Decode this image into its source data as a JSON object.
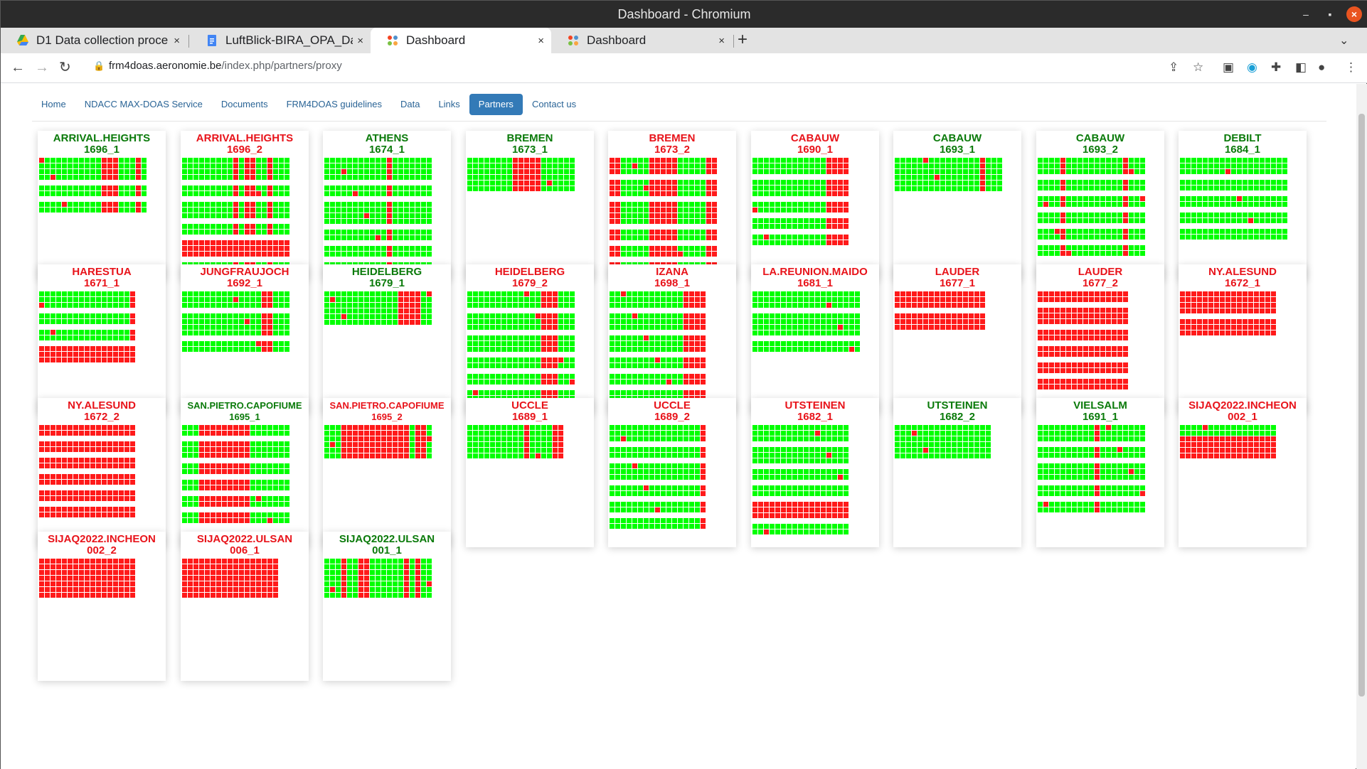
{
  "window": {
    "title": "Dashboard - Chromium",
    "controls": [
      "–",
      "▪",
      "×"
    ]
  },
  "tabs": [
    {
      "label": "D1 Data collection proce",
      "icon": "google-drive-icon",
      "close": "×"
    },
    {
      "label": "LuftBlick-BIRA_OPA_Da",
      "icon": "google-docs-icon",
      "close": "×"
    },
    {
      "label": "Dashboard",
      "icon": "joomla-icon",
      "close": "×"
    },
    {
      "label": "Dashboard",
      "icon": "joomla-icon",
      "close": "×"
    }
  ],
  "address": {
    "host": "frm4doas.aeronomie.be",
    "path": "/index.php/partners/proxy"
  },
  "nav": [
    "Home",
    "NDACC MAX-DOAS Service",
    "Documents",
    "FRM4DOAS guidelines",
    "Data",
    "Links",
    "Partners",
    "Contact us"
  ],
  "nav_active": 6,
  "colors": {
    "ok": "#00ff00",
    "fail": "#ff1a1a",
    "title_ok": "#0a7a0a",
    "title_fail": "#e8131a",
    "nav_active": "#337ab7"
  },
  "stations": [
    {
      "name": "ARRIVAL.HEIGHTS",
      "id": "1696_1",
      "status": "ok",
      "cols": 19,
      "groups": [
        [
          "g",
          4
        ],
        [
          "s",
          0
        ],
        [
          "g",
          2
        ],
        [
          "s",
          0
        ],
        [
          "g",
          2
        ]
      ],
      "red_cols": [
        [
          11,
          11
        ],
        [
          12,
          13
        ],
        [
          17,
          17
        ]
      ]
    },
    {
      "name": "ARRIVAL.HEIGHTS",
      "id": "1696_2",
      "status": "fail",
      "cols": 19,
      "groups": [
        [
          "g",
          4
        ],
        [
          "s",
          0
        ],
        [
          "g",
          2
        ],
        [
          "s",
          0
        ],
        [
          "g",
          3
        ],
        [
          "s",
          0
        ],
        [
          "g",
          2
        ],
        [
          "s",
          0
        ],
        [
          "r",
          3
        ],
        [
          "s",
          0
        ],
        [
          "g",
          2
        ]
      ],
      "red_cols": [
        [
          9,
          9
        ],
        [
          11,
          12
        ],
        [
          15,
          15
        ]
      ]
    },
    {
      "name": "ATHENS",
      "id": "1674_1",
      "status": "ok",
      "cols": 19,
      "groups": [
        [
          "g",
          4
        ],
        [
          "s",
          0
        ],
        [
          "g",
          2
        ],
        [
          "s",
          0
        ],
        [
          "g",
          4
        ],
        [
          "s",
          0
        ],
        [
          "g",
          2
        ],
        [
          "s",
          0
        ],
        [
          "g",
          2
        ],
        [
          "s",
          0
        ],
        [
          "g",
          2
        ]
      ],
      "red_cols": [
        [
          11,
          11
        ]
      ]
    },
    {
      "name": "BREMEN",
      "id": "1673_1",
      "status": "ok",
      "cols": 19,
      "groups": [
        [
          "g",
          6
        ]
      ],
      "red_cols": [
        [
          8,
          11
        ],
        [
          12,
          12
        ]
      ]
    },
    {
      "name": "BREMEN",
      "id": "1673_2",
      "status": "fail",
      "cols": 19,
      "groups": [
        [
          "g",
          3
        ],
        [
          "s",
          0
        ],
        [
          "g",
          3
        ],
        [
          "s",
          0
        ],
        [
          "g",
          4
        ],
        [
          "s",
          0
        ],
        [
          "g",
          2
        ],
        [
          "s",
          0
        ],
        [
          "g",
          2
        ],
        [
          "s",
          0
        ],
        [
          "g",
          2
        ]
      ],
      "red_cols": [
        [
          0,
          1
        ],
        [
          7,
          11
        ],
        [
          17,
          18
        ]
      ]
    },
    {
      "name": "CABAUW",
      "id": "1690_1",
      "status": "fail",
      "cols": 17,
      "groups": [
        [
          "g",
          3
        ],
        [
          "s",
          0
        ],
        [
          "g",
          3
        ],
        [
          "s",
          0
        ],
        [
          "g",
          2
        ],
        [
          "s",
          0
        ],
        [
          "g",
          2
        ],
        [
          "s",
          0
        ],
        [
          "g",
          2
        ]
      ],
      "red_cols": [
        [
          13,
          16
        ]
      ]
    },
    {
      "name": "CABAUW",
      "id": "1693_1",
      "status": "ok",
      "cols": 19,
      "groups": [
        [
          "g",
          6
        ]
      ],
      "red_cols": [
        [
          15,
          15
        ]
      ]
    },
    {
      "name": "CABAUW",
      "id": "1693_2",
      "status": "ok",
      "cols": 19,
      "groups": [
        [
          "g",
          3
        ],
        [
          "s",
          0
        ],
        [
          "g",
          2
        ],
        [
          "s",
          0
        ],
        [
          "g",
          2
        ],
        [
          "s",
          0
        ],
        [
          "g",
          2
        ],
        [
          "s",
          0
        ],
        [
          "g",
          2
        ],
        [
          "s",
          0
        ],
        [
          "g",
          2
        ]
      ],
      "red_cols": [
        [
          4,
          4
        ],
        [
          15,
          15
        ]
      ]
    },
    {
      "name": "DEBILT",
      "id": "1684_1",
      "status": "ok",
      "cols": 19,
      "groups": [
        [
          "g",
          3
        ],
        [
          "s",
          0
        ],
        [
          "g",
          2
        ],
        [
          "s",
          0
        ],
        [
          "g",
          2
        ],
        [
          "s",
          0
        ],
        [
          "g",
          2
        ],
        [
          "s",
          0
        ],
        [
          "g",
          2
        ]
      ],
      "red_cols": []
    },
    {
      "name": "HARESTUA",
      "id": "1671_1",
      "status": "fail",
      "cols": 17,
      "groups": [
        [
          "g",
          3
        ],
        [
          "s",
          0
        ],
        [
          "g",
          2
        ],
        [
          "s",
          0
        ],
        [
          "g",
          2
        ],
        [
          "s",
          0
        ],
        [
          "r",
          3
        ]
      ],
      "red_cols": [
        [
          16,
          16
        ]
      ]
    },
    {
      "name": "JUNGFRAUJOCH",
      "id": "1692_1",
      "status": "fail",
      "cols": 19,
      "groups": [
        [
          "g",
          3
        ],
        [
          "s",
          0
        ],
        [
          "g",
          4
        ],
        [
          "s",
          0
        ],
        [
          "g",
          2
        ]
      ],
      "red_cols": [
        [
          14,
          15
        ]
      ]
    },
    {
      "name": "HEIDELBERG",
      "id": "1679_1",
      "status": "ok",
      "cols": 19,
      "groups": [
        [
          "g",
          6
        ]
      ],
      "red_cols": [
        [
          13,
          16
        ]
      ]
    },
    {
      "name": "HEIDELBERG",
      "id": "1679_2",
      "status": "fail",
      "cols": 19,
      "groups": [
        [
          "g",
          3
        ],
        [
          "s",
          0
        ],
        [
          "g",
          3
        ],
        [
          "s",
          0
        ],
        [
          "g",
          3
        ],
        [
          "s",
          0
        ],
        [
          "g",
          2
        ],
        [
          "s",
          0
        ],
        [
          "g",
          2
        ],
        [
          "s",
          0
        ],
        [
          "g",
          2
        ],
        [
          "s",
          0
        ],
        [
          "g",
          2
        ]
      ],
      "red_cols": [
        [
          13,
          15
        ]
      ]
    },
    {
      "name": "IZANA",
      "id": "1698_1",
      "status": "fail",
      "cols": 17,
      "groups": [
        [
          "g",
          3
        ],
        [
          "s",
          0
        ],
        [
          "g",
          3
        ],
        [
          "s",
          0
        ],
        [
          "g",
          3
        ],
        [
          "s",
          0
        ],
        [
          "g",
          2
        ],
        [
          "s",
          0
        ],
        [
          "g",
          2
        ],
        [
          "s",
          0
        ],
        [
          "g",
          2
        ]
      ],
      "red_cols": [
        [
          13,
          16
        ]
      ]
    },
    {
      "name": "LA.REUNION.MAIDO",
      "id": "1681_1",
      "status": "fail",
      "cols": 19,
      "groups": [
        [
          "g",
          3
        ],
        [
          "s",
          0
        ],
        [
          "g",
          4
        ],
        [
          "s",
          0
        ],
        [
          "g",
          2
        ]
      ],
      "red_cols": []
    },
    {
      "name": "LAUDER",
      "id": "1677_1",
      "status": "fail",
      "cols": 16,
      "groups": [
        [
          "r",
          3
        ],
        [
          "s",
          0
        ],
        [
          "r",
          3
        ]
      ],
      "red_cols": []
    },
    {
      "name": "LAUDER",
      "id": "1677_2",
      "status": "fail",
      "cols": 16,
      "groups": [
        [
          "r",
          2
        ],
        [
          "s",
          0
        ],
        [
          "r",
          3
        ],
        [
          "s",
          0
        ],
        [
          "r",
          2
        ],
        [
          "s",
          0
        ],
        [
          "r",
          2
        ],
        [
          "s",
          0
        ],
        [
          "r",
          2
        ],
        [
          "s",
          0
        ],
        [
          "r",
          2
        ]
      ],
      "red_cols": []
    },
    {
      "name": "NY.ALESUND",
      "id": "1672_1",
      "status": "fail",
      "cols": 17,
      "groups": [
        [
          "r",
          4
        ],
        [
          "s",
          0
        ],
        [
          "r",
          3
        ]
      ],
      "red_cols": []
    },
    {
      "name": "NY.ALESUND",
      "id": "1672_2",
      "status": "fail",
      "cols": 17,
      "groups": [
        [
          "r",
          2
        ],
        [
          "s",
          0
        ],
        [
          "r",
          2
        ],
        [
          "s",
          0
        ],
        [
          "r",
          2
        ],
        [
          "s",
          0
        ],
        [
          "r",
          2
        ],
        [
          "s",
          0
        ],
        [
          "r",
          2
        ],
        [
          "s",
          0
        ],
        [
          "r",
          2
        ]
      ],
      "red_cols": []
    },
    {
      "name": "SAN.PIETRO.CAPOFIUME",
      "id": "1695_1",
      "status": "ok",
      "cols": 19,
      "groups": [
        [
          "g",
          2
        ],
        [
          "s",
          0
        ],
        [
          "g",
          3
        ],
        [
          "s",
          0
        ],
        [
          "g",
          2
        ],
        [
          "s",
          0
        ],
        [
          "g",
          2
        ],
        [
          "s",
          0
        ],
        [
          "g",
          2
        ],
        [
          "s",
          0
        ],
        [
          "g",
          2
        ]
      ],
      "red_cols": [
        [
          3,
          11
        ]
      ]
    },
    {
      "name": "SAN.PIETRO.CAPOFIUME",
      "id": "1695_2",
      "status": "fail",
      "cols": 19,
      "groups": [
        [
          "g",
          6
        ]
      ],
      "red_cols": [
        [
          3,
          14
        ],
        [
          16,
          17
        ]
      ]
    },
    {
      "name": "UCCLE",
      "id": "1689_1",
      "status": "fail",
      "cols": 17,
      "groups": [
        [
          "g",
          6
        ]
      ],
      "red_cols": [
        [
          10,
          10
        ],
        [
          15,
          16
        ]
      ]
    },
    {
      "name": "UCCLE",
      "id": "1689_2",
      "status": "fail",
      "cols": 17,
      "groups": [
        [
          "g",
          3
        ],
        [
          "s",
          0
        ],
        [
          "g",
          2
        ],
        [
          "s",
          0
        ],
        [
          "g",
          3
        ],
        [
          "s",
          0
        ],
        [
          "g",
          2
        ],
        [
          "s",
          0
        ],
        [
          "g",
          2
        ],
        [
          "s",
          0
        ],
        [
          "g",
          2
        ]
      ],
      "red_cols": [
        [
          16,
          16
        ]
      ]
    },
    {
      "name": "UTSTEINEN",
      "id": "1682_1",
      "status": "fail",
      "cols": 17,
      "groups": [
        [
          "g",
          3
        ],
        [
          "s",
          0
        ],
        [
          "g",
          3
        ],
        [
          "s",
          0
        ],
        [
          "g",
          2
        ],
        [
          "s",
          0
        ],
        [
          "g",
          2
        ],
        [
          "s",
          0
        ],
        [
          "r",
          3
        ],
        [
          "s",
          0
        ],
        [
          "g",
          2
        ]
      ],
      "red_cols": []
    },
    {
      "name": "UTSTEINEN",
      "id": "1682_2",
      "status": "ok",
      "cols": 17,
      "groups": [
        [
          "g",
          6
        ]
      ],
      "red_cols": []
    },
    {
      "name": "VIELSALM",
      "id": "1691_1",
      "status": "ok",
      "cols": 19,
      "groups": [
        [
          "g",
          3
        ],
        [
          "s",
          0
        ],
        [
          "g",
          2
        ],
        [
          "s",
          0
        ],
        [
          "g",
          3
        ],
        [
          "s",
          0
        ],
        [
          "g",
          2
        ],
        [
          "s",
          0
        ],
        [
          "g",
          2
        ]
      ],
      "red_cols": [
        [
          10,
          10
        ]
      ]
    },
    {
      "name": "SIJAQ2022.INCHEON",
      "id": "002_1",
      "status": "fail",
      "cols": 17,
      "groups": [
        [
          "g",
          2
        ],
        [
          "r",
          4
        ]
      ],
      "red_cols": []
    },
    {
      "name": "SIJAQ2022.INCHEON",
      "id": "002_2",
      "status": "fail",
      "cols": 17,
      "groups": [
        [
          "r",
          7
        ]
      ],
      "red_cols": []
    },
    {
      "name": "SIJAQ2022.ULSAN",
      "id": "006_1",
      "status": "fail",
      "cols": 17,
      "groups": [
        [
          "r",
          7
        ]
      ],
      "red_cols": []
    },
    {
      "name": "SIJAQ2022.ULSAN",
      "id": "001_1",
      "status": "ok",
      "cols": 19,
      "groups": [
        [
          "g",
          7
        ]
      ],
      "red_cols": [
        [
          3,
          3
        ],
        [
          6,
          7
        ],
        [
          14,
          14
        ],
        [
          16,
          16
        ]
      ]
    }
  ]
}
